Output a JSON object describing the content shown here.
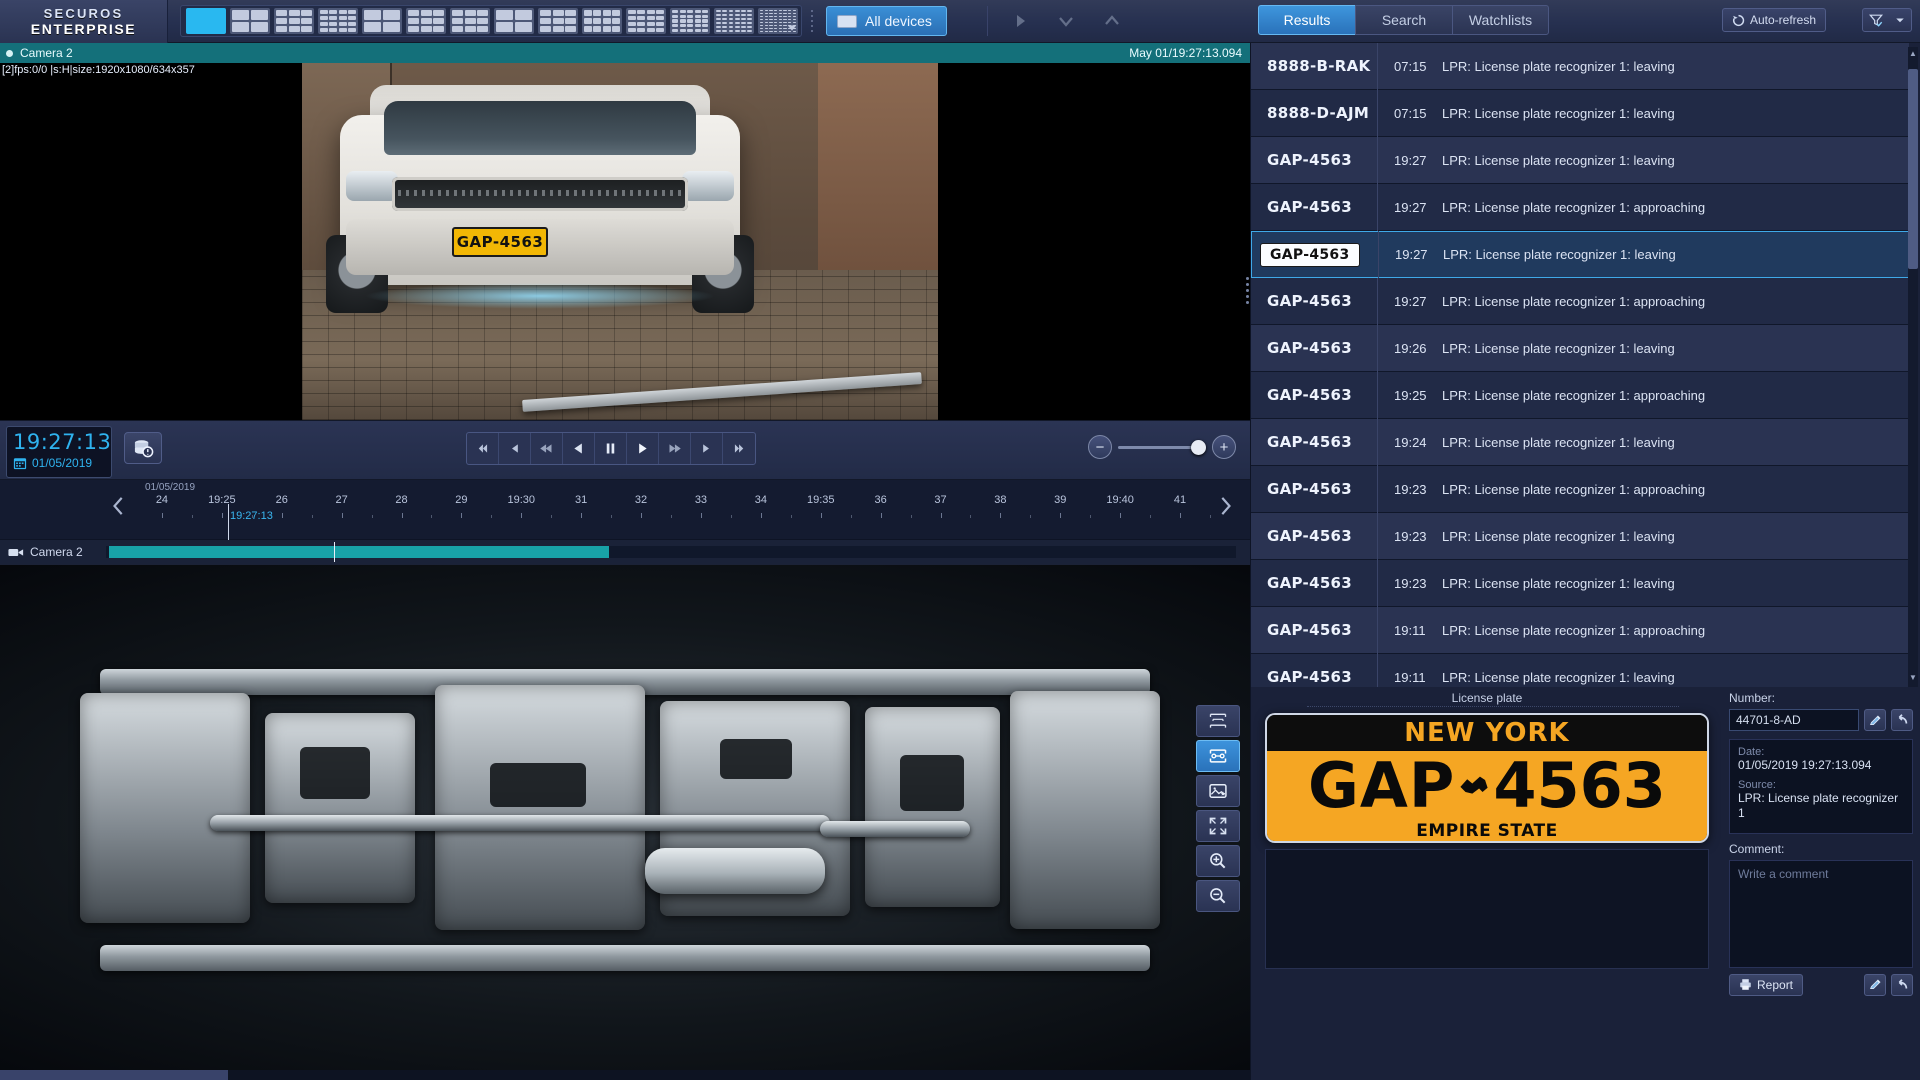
{
  "app": {
    "logo_line1": "SECUROS",
    "logo_line2": "ENTERPRISE"
  },
  "toolbar": {
    "all_devices_label": "All devices",
    "layout_count": 14
  },
  "tabs": [
    {
      "label": "Results",
      "active": true
    },
    {
      "label": "Search",
      "active": false
    },
    {
      "label": "Watchlists",
      "active": false
    }
  ],
  "header_right": {
    "auto_refresh_label": "Auto-refresh",
    "filter_icon": "funnel-icon",
    "dropdown_icon": "chevron-down-icon"
  },
  "camera_top": {
    "title": "Camera 2",
    "timestamp": "May 01/19:27:13.094",
    "osd": "[2]fps:0/0 |s:H|size:1920x1080/634x357",
    "plate_in_scene": "GAP-4563"
  },
  "transport": {
    "time": "19:27:13",
    "date": "01/05/2019",
    "db_button_icon": "database-search-icon",
    "buttons": [
      "skip-to-start",
      "step-back",
      "rewind",
      "play-reverse",
      "pause",
      "play",
      "fast-forward",
      "step-forward",
      "skip-to-end"
    ],
    "zoom_out_label": "−",
    "zoom_in_label": "+"
  },
  "timeline": {
    "date_label": "01/05/2019",
    "ticks": [
      "24",
      "19:25",
      "26",
      "27",
      "28",
      "29",
      "19:30",
      "31",
      "32",
      "33",
      "34",
      "19:35",
      "36",
      "37",
      "38",
      "39",
      "19:40",
      "41"
    ],
    "cursor_label": "19:27:13",
    "track_label": "Camera 2",
    "prev_icon": "chevron-left-icon",
    "next_icon": "chevron-right-icon"
  },
  "video_tools": [
    {
      "name": "measure-area-icon",
      "active": false
    },
    {
      "name": "measure-width-icon",
      "active": true
    },
    {
      "name": "snapshot-icon",
      "active": false
    },
    {
      "name": "fullscreen-icon",
      "active": false
    },
    {
      "name": "zoom-in-icon",
      "active": false
    },
    {
      "name": "zoom-out-icon",
      "active": false
    }
  ],
  "results": {
    "rows": [
      {
        "plate": "8888-B-RAK",
        "time": "07:15",
        "event": "LPR: License plate recognizer 1: leaving",
        "selected": false
      },
      {
        "plate": "8888-D-AJM",
        "time": "07:15",
        "event": "LPR: License plate recognizer 1: leaving",
        "selected": false
      },
      {
        "plate": "GAP-4563",
        "time": "19:27",
        "event": "LPR: License plate recognizer 1: leaving",
        "selected": false
      },
      {
        "plate": "GAP-4563",
        "time": "19:27",
        "event": "LPR: License plate recognizer 1: approaching",
        "selected": false
      },
      {
        "plate": "GAP-4563",
        "time": "19:27",
        "event": "LPR: License plate recognizer 1: leaving",
        "selected": true
      },
      {
        "plate": "GAP-4563",
        "time": "19:27",
        "event": "LPR: License plate recognizer 1: approaching",
        "selected": false
      },
      {
        "plate": "GAP-4563",
        "time": "19:26",
        "event": "LPR: License plate recognizer 1: leaving",
        "selected": false
      },
      {
        "plate": "GAP-4563",
        "time": "19:25",
        "event": "LPR: License plate recognizer 1: approaching",
        "selected": false
      },
      {
        "plate": "GAP-4563",
        "time": "19:24",
        "event": "LPR: License plate recognizer 1: leaving",
        "selected": false
      },
      {
        "plate": "GAP-4563",
        "time": "19:23",
        "event": "LPR: License plate recognizer 1: approaching",
        "selected": false
      },
      {
        "plate": "GAP-4563",
        "time": "19:23",
        "event": "LPR: License plate recognizer 1: leaving",
        "selected": false
      },
      {
        "plate": "GAP-4563",
        "time": "19:23",
        "event": "LPR: License plate recognizer 1: leaving",
        "selected": false
      },
      {
        "plate": "GAP-4563",
        "time": "19:11",
        "event": "LPR: License plate recognizer 1: approaching",
        "selected": false
      },
      {
        "plate": "GAP-4563",
        "time": "19:11",
        "event": "LPR: License plate recognizer 1: leaving",
        "selected": false
      }
    ]
  },
  "detail": {
    "license_plate_title": "License plate",
    "plate": {
      "state": "NEW YORK",
      "number": "GAP✦ 4563",
      "number_left": "GAP",
      "number_right": "4563",
      "slogan": "EMPIRE STATE",
      "bg_color": "#f5a623",
      "text_color": "#0a0a0a"
    },
    "number_label": "Number:",
    "number_value": "44701-8-AD",
    "date_label": "Date:",
    "date_value": "01/05/2019 19:27:13.094",
    "source_label": "Source:",
    "source_value": "LPR: License plate recognizer 1",
    "comment_label": "Comment:",
    "comment_placeholder": "Write a comment",
    "report_label": "Report",
    "edit_icon": "pencil-icon",
    "undo_icon": "undo-icon"
  },
  "colors": {
    "accent": "#3fa9e8",
    "teal_header": "#14707a",
    "panel_bg": "#1a2139",
    "plate_orange": "#f5a623"
  }
}
